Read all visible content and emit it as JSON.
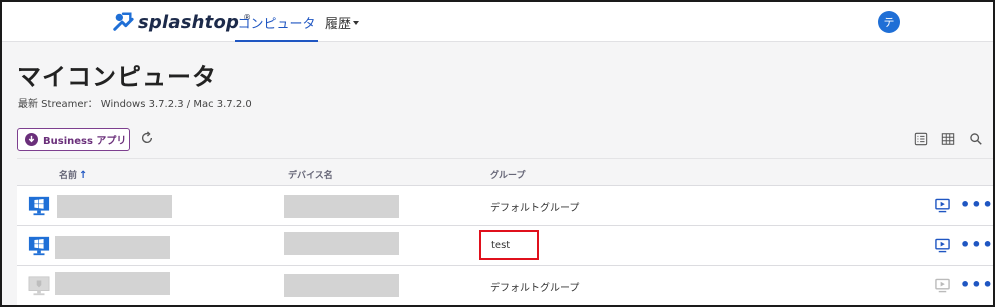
{
  "brand": {
    "name": "splashtop",
    "tm": "®"
  },
  "nav": {
    "tabs": [
      {
        "label": "コンピュータ",
        "active": true
      },
      {
        "label": "履歴"
      }
    ]
  },
  "user": {
    "avatar_initial": "テ"
  },
  "page": {
    "title": "マイコンピュータ",
    "streamer_info": "最新 Streamer： Windows 3.7.2.3 / Mac 3.7.2.0"
  },
  "toolbar": {
    "business_app_label": "Business アプリ"
  },
  "table": {
    "columns": {
      "name": "名前",
      "device_name": "デバイス名",
      "group": "グループ"
    },
    "sort_indicator": "↑",
    "rows": [
      {
        "group": "デフォルトグループ",
        "status": "online",
        "os": "windows"
      },
      {
        "group": "test",
        "status": "online",
        "os": "windows",
        "highlighted": true
      },
      {
        "group": "デフォルトグループ",
        "status": "offline",
        "os": "windows"
      }
    ],
    "more_label": "•••"
  },
  "colors": {
    "accent": "#1f56c2",
    "business": "#6a2f7a",
    "highlight": "#e0101c"
  }
}
